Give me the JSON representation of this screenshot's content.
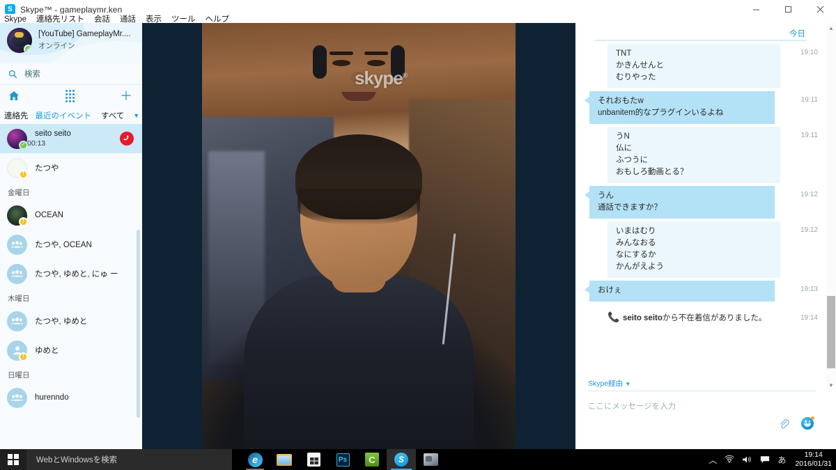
{
  "window": {
    "title": "Skype™ - gameplaymr.ken",
    "logo_letter": "S",
    "controls": {
      "minimize": "minimize-icon",
      "maximize": "maximize-icon",
      "close": "close-icon"
    }
  },
  "menubar": {
    "items": [
      "Skype",
      "連絡先リスト",
      "会話",
      "通話",
      "表示",
      "ツール",
      "ヘルプ"
    ]
  },
  "sidebar": {
    "me": {
      "name": "[YouTube] GameplayMr....",
      "status": "オンライン",
      "presence": "online"
    },
    "search": {
      "placeholder": "検索",
      "icon": "search-icon"
    },
    "tools": {
      "home": "home-icon",
      "dialpad": "dialpad-icon",
      "add": "add-contact-icon"
    },
    "tabs": [
      {
        "label": "連絡先",
        "active": false
      },
      {
        "label": "最近のイベント",
        "active": true
      }
    ],
    "filter": {
      "label": "すべて",
      "caret": "chevron-down-icon"
    },
    "list": [
      {
        "type": "conversation",
        "name": "seito seito",
        "sub": "00:13",
        "avatar": "photo-purple",
        "presence": "online",
        "selected": true,
        "action": "hangup-button"
      },
      {
        "type": "conversation",
        "name": "たつや",
        "sub": "",
        "avatar": "photo-sheep",
        "presence": "away",
        "selected": false
      },
      {
        "type": "daygroup",
        "label": "金曜日"
      },
      {
        "type": "conversation",
        "name": "OCEAN",
        "sub": "",
        "avatar": "photo-dark",
        "presence": "away",
        "selected": false
      },
      {
        "type": "conversation",
        "name": "たつや, OCEAN",
        "sub": "",
        "avatar": "group",
        "presence": "",
        "selected": false
      },
      {
        "type": "conversation",
        "name": "たつや, ゆめと, にゅ ー",
        "sub": "",
        "avatar": "group",
        "presence": "",
        "selected": false
      },
      {
        "type": "daygroup",
        "label": "木曜日"
      },
      {
        "type": "conversation",
        "name": "たつや, ゆめと",
        "sub": "",
        "avatar": "group",
        "presence": "",
        "selected": false
      },
      {
        "type": "conversation",
        "name": "ゆめと",
        "sub": "",
        "avatar": "person",
        "presence": "away",
        "selected": false
      },
      {
        "type": "daygroup",
        "label": "日曜日"
      },
      {
        "type": "conversation",
        "name": "hurenndo",
        "sub": "",
        "avatar": "group",
        "presence": "",
        "selected": false
      }
    ]
  },
  "video": {
    "watermark": "skype",
    "watermark_sup": "®",
    "background_color": "#0f2233"
  },
  "chat": {
    "day_divider": "今日",
    "messages": [
      {
        "dir": "in",
        "text": "TNT\nかきんせんと\nむりやった",
        "time": "19:10"
      },
      {
        "dir": "out",
        "text": "それおもたw\nunbanitem的なプラグインいるよね",
        "time": "19:11"
      },
      {
        "dir": "in",
        "text": "うN\n仏に\nふつうに\nおもしろ動画とる？",
        "time": "19:11"
      },
      {
        "dir": "out",
        "text": "うん\n通話できますか？",
        "time": "19:12"
      },
      {
        "dir": "in",
        "text": "いまはむり\nみんなおる\nなにするか\nかんがえよう",
        "time": "19:12"
      },
      {
        "dir": "out",
        "text": "おけぇ",
        "time": "19:13"
      }
    ],
    "system_message": {
      "icon": "phone-icon",
      "bold_part": "seito seito",
      "rest": "から不在着信がありました。",
      "time": "19:14"
    },
    "compose": {
      "via_label": "Skype経由",
      "via_caret": "chevron-down-icon",
      "placeholder": "ここにメッセージを入力",
      "attach_icon": "paperclip-icon",
      "emoji_icon": "emoji-icon"
    },
    "scrollbar": {
      "up": "chevron-up-icon",
      "down": "chevron-down-icon"
    }
  },
  "taskbar": {
    "start": "windows-start-icon",
    "search_placeholder": "WebとWindowsを検索",
    "apps": [
      {
        "name": "edge",
        "icon": "edge-icon",
        "state": "open"
      },
      {
        "name": "file-explorer",
        "icon": "folder-icon",
        "state": "idle"
      },
      {
        "name": "store",
        "icon": "store-icon",
        "state": "idle"
      },
      {
        "name": "photoshop",
        "icon": "photoshop-icon",
        "state": "idle"
      },
      {
        "name": "camtasia",
        "icon": "camtasia-icon",
        "state": "idle"
      },
      {
        "name": "skype",
        "icon": "skype-icon",
        "state": "active"
      },
      {
        "name": "misc-app",
        "icon": "misc-app-icon",
        "state": "idle"
      }
    ],
    "tray": {
      "chevron": "chevron-up-icon",
      "network": "wifi-icon",
      "volume": "speaker-icon",
      "action_center": "action-center-icon",
      "ime": "あ",
      "time": "19:14",
      "date": "2016/01/31"
    }
  }
}
